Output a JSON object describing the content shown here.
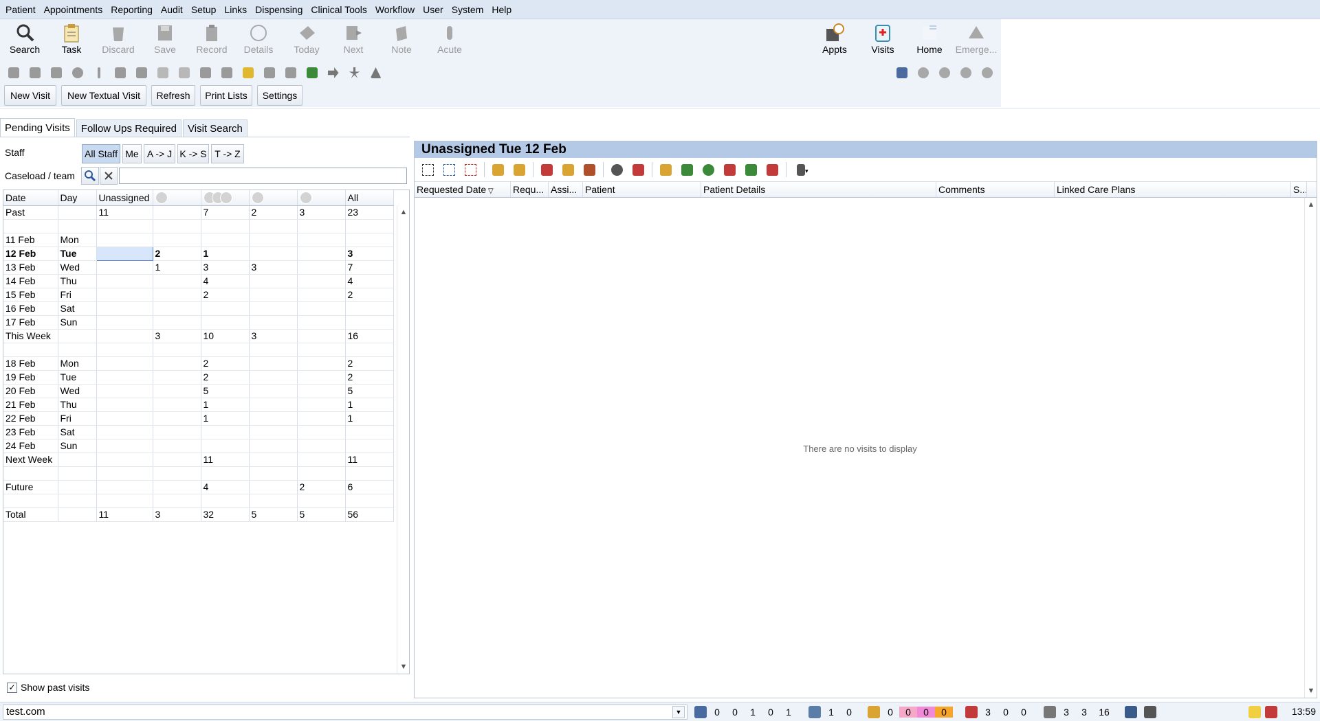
{
  "menu": [
    "Patient",
    "Appointments",
    "Reporting",
    "Audit",
    "Setup",
    "Links",
    "Dispensing",
    "Clinical Tools",
    "Workflow",
    "User",
    "System",
    "Help"
  ],
  "toolbar": {
    "buttons": [
      {
        "label": "Search",
        "icon": "search-icon",
        "enabled": true
      },
      {
        "label": "Task",
        "icon": "clipboard-icon",
        "enabled": true
      },
      {
        "label": "Discard",
        "icon": "discard-icon",
        "enabled": false
      },
      {
        "label": "Save",
        "icon": "save-icon",
        "enabled": false
      },
      {
        "label": "Record",
        "icon": "record-icon",
        "enabled": false
      },
      {
        "label": "Details",
        "icon": "details-icon",
        "enabled": false
      },
      {
        "label": "Today",
        "icon": "today-icon",
        "enabled": false
      },
      {
        "label": "Next",
        "icon": "next-icon",
        "enabled": false
      },
      {
        "label": "Note",
        "icon": "note-icon",
        "enabled": false
      },
      {
        "label": "Acute",
        "icon": "acute-icon",
        "enabled": false
      }
    ],
    "right_buttons": [
      {
        "label": "Appts",
        "icon": "appointments-icon",
        "enabled": true
      },
      {
        "label": "Visits",
        "icon": "visits-icon",
        "enabled": true
      },
      {
        "label": "Home",
        "icon": "home-icon",
        "enabled": true
      },
      {
        "label": "Emerge...",
        "icon": "emergency-icon",
        "enabled": false
      }
    ]
  },
  "actions": {
    "new_visit": "New Visit",
    "new_textual_visit": "New Textual Visit",
    "refresh": "Refresh",
    "print_lists": "Print Lists",
    "settings": "Settings"
  },
  "tabs": [
    "Pending Visits",
    "Follow Ups Required",
    "Visit Search"
  ],
  "staff": {
    "label": "Staff",
    "filters": [
      "All Staff",
      "Me",
      "A -> J",
      "K -> S",
      "T -> Z"
    ],
    "caseload_label": "Caseload / team"
  },
  "grid": {
    "headers": [
      "Date",
      "Day",
      "Unassigned",
      "",
      "",
      "",
      "",
      "All"
    ],
    "rows": [
      [
        "Past",
        "",
        "11",
        "",
        "7",
        "2",
        "3",
        "23"
      ],
      [
        "",
        "",
        "",
        "",
        "",
        "",
        "",
        ""
      ],
      [
        "11 Feb",
        "Mon",
        "",
        "",
        "",
        "",
        "",
        ""
      ],
      [
        "12 Feb",
        "Tue",
        "",
        "2",
        "1",
        "",
        "",
        "3"
      ],
      [
        "13 Feb",
        "Wed",
        "",
        "1",
        "3",
        "3",
        "",
        "7"
      ],
      [
        "14 Feb",
        "Thu",
        "",
        "",
        "4",
        "",
        "",
        "4"
      ],
      [
        "15 Feb",
        "Fri",
        "",
        "",
        "2",
        "",
        "",
        "2"
      ],
      [
        "16 Feb",
        "Sat",
        "",
        "",
        "",
        "",
        "",
        ""
      ],
      [
        "17 Feb",
        "Sun",
        "",
        "",
        "",
        "",
        "",
        ""
      ],
      [
        "This Week",
        "",
        "",
        "3",
        "10",
        "3",
        "",
        "16"
      ],
      [
        "",
        "",
        "",
        "",
        "",
        "",
        "",
        ""
      ],
      [
        "18 Feb",
        "Mon",
        "",
        "",
        "2",
        "",
        "",
        "2"
      ],
      [
        "19 Feb",
        "Tue",
        "",
        "",
        "2",
        "",
        "",
        "2"
      ],
      [
        "20 Feb",
        "Wed",
        "",
        "",
        "5",
        "",
        "",
        "5"
      ],
      [
        "21 Feb",
        "Thu",
        "",
        "",
        "1",
        "",
        "",
        "1"
      ],
      [
        "22 Feb",
        "Fri",
        "",
        "",
        "1",
        "",
        "",
        "1"
      ],
      [
        "23 Feb",
        "Sat",
        "",
        "",
        "",
        "",
        "",
        ""
      ],
      [
        "24 Feb",
        "Sun",
        "",
        "",
        "",
        "",
        "",
        ""
      ],
      [
        "Next Week",
        "",
        "",
        "",
        "11",
        "",
        "",
        "11"
      ],
      [
        "",
        "",
        "",
        "",
        "",
        "",
        "",
        ""
      ],
      [
        "Future",
        "",
        "",
        "",
        "4",
        "",
        "2",
        "6"
      ],
      [
        "",
        "",
        "",
        "",
        "",
        "",
        "",
        ""
      ],
      [
        "Total",
        "",
        "11",
        "3",
        "32",
        "5",
        "5",
        "56"
      ]
    ]
  },
  "show_past_visits": {
    "label": "Show past visits",
    "checked": true
  },
  "right_panel": {
    "title": "Unassigned Tue 12 Feb",
    "columns": [
      "Requested Date",
      "Requ...",
      "Assi...",
      "Patient",
      "Patient Details",
      "Comments",
      "Linked Care Plans",
      "S..."
    ],
    "empty_message": "There are no visits to display"
  },
  "status": {
    "user": "test.com",
    "group1": [
      "0",
      "0",
      "1",
      "0",
      "1"
    ],
    "group2": [
      "1",
      "0"
    ],
    "group3": [
      "0",
      "0",
      "0",
      "0"
    ],
    "group4": [
      "3",
      "0",
      "0"
    ],
    "group5": [
      "3",
      "3",
      "16"
    ],
    "time": "13:59"
  }
}
